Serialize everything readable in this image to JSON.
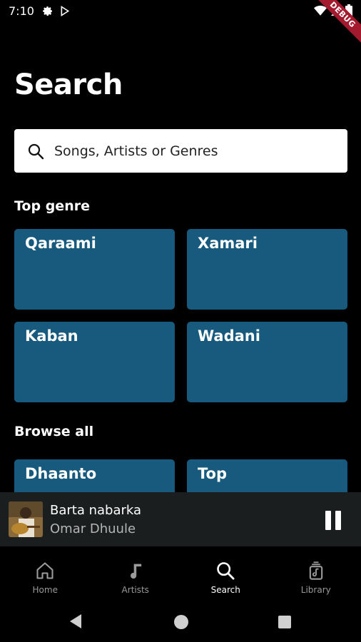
{
  "status_bar": {
    "time": "7:10",
    "icons_left": [
      "gear-icon",
      "play-store-icon"
    ],
    "icons_right": [
      "wifi-icon",
      "signal-icon",
      "battery-icon"
    ],
    "debug_label": "DEBUG"
  },
  "page": {
    "title": "Search"
  },
  "search": {
    "placeholder": "Songs, Artists or Genres"
  },
  "sections": {
    "top_genre": {
      "title": "Top genre",
      "tiles": [
        "Qaraami",
        "Xamari",
        "Kaban",
        "Wadani"
      ]
    },
    "browse_all": {
      "title": "Browse all",
      "tiles": [
        "Dhaanto",
        "Top"
      ]
    }
  },
  "player": {
    "title": "Barta nabarka",
    "artist": "Omar Dhuule",
    "state": "playing"
  },
  "bottom_nav": {
    "items": [
      {
        "label": "Home",
        "icon": "home-icon",
        "active": false
      },
      {
        "label": "Artists",
        "icon": "music-note-icon",
        "active": false
      },
      {
        "label": "Search",
        "icon": "search-icon",
        "active": true
      },
      {
        "label": "Library",
        "icon": "library-icon",
        "active": false
      }
    ]
  },
  "colors": {
    "background": "#000000",
    "tile": "#175a7e",
    "player_bg": "#1b1e1e",
    "debug_ribbon": "#a3192e"
  }
}
